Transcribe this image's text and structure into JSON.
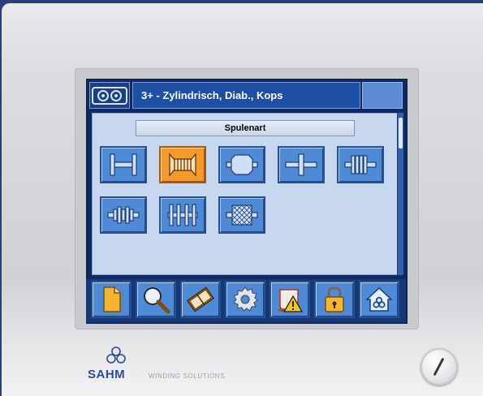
{
  "header": {
    "title": "3+ - Zylindrisch, Diab., Kops",
    "logo_icon": "double-spool-icon"
  },
  "section": {
    "label": "Spulenart"
  },
  "spool_types": [
    {
      "icon": "h-spool-icon",
      "selected": false
    },
    {
      "icon": "flanged-coil-spool-icon",
      "selected": true
    },
    {
      "icon": "conical-drum-spool-icon",
      "selected": false
    },
    {
      "icon": "cross-spool-icon",
      "selected": false
    },
    {
      "icon": "multi-disc-spool-icon",
      "selected": false
    },
    {
      "icon": "segmented-spool-icon",
      "selected": false
    },
    {
      "icon": "multi-flange-spool-icon",
      "selected": false
    },
    {
      "icon": "crosshatch-spool-icon",
      "selected": false
    }
  ],
  "toolbar": [
    {
      "icon": "document-icon"
    },
    {
      "icon": "magnifier-icon"
    },
    {
      "icon": "book-icon"
    },
    {
      "icon": "gear-icon"
    },
    {
      "icon": "warning-scroll-icon"
    },
    {
      "icon": "padlock-icon"
    },
    {
      "icon": "home-icon"
    }
  ],
  "brand": {
    "name": "SAHM",
    "tagline": "WINDING SOLUTIONS"
  },
  "colors": {
    "accent": "#1e4fa3",
    "selected": "#f39a2a",
    "content_bg": "#c8d7f0"
  }
}
